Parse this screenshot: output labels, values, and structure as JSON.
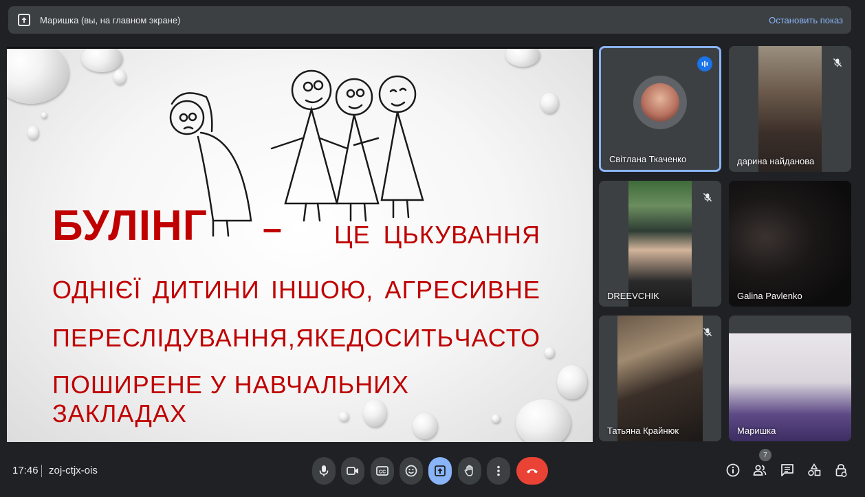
{
  "presenting_bar": {
    "text": "Маришка (вы, на главном экране)",
    "stop_label": "Остановить показ"
  },
  "slide": {
    "title": "БУЛІНГ",
    "dash": "–",
    "line0": [
      "ЦЕ",
      "ЦЬКУВАННЯ"
    ],
    "line1": [
      "ОДНІЄЇ",
      "ДИТИНИ",
      "ІНШОЮ,",
      "АГРЕСИВНЕ"
    ],
    "line2": [
      "ПЕРЕСЛІДУВАННЯ,",
      "ЯКЕ",
      "ДОСИТЬ",
      "ЧАСТО"
    ],
    "line3": "ПОШИРЕНЕ У НАВЧАЛЬНИХ ЗАКЛАДАХ"
  },
  "participants": [
    {
      "name": "Світлана Ткаченко",
      "status": "speaking"
    },
    {
      "name": "дарина найданова",
      "status": "muted"
    },
    {
      "name": "DREEVCHIK",
      "status": "muted"
    },
    {
      "name": "Galina Pavlenko",
      "status": "unmuted"
    },
    {
      "name": "Татьяна Крайнюк",
      "status": "muted"
    },
    {
      "name": "Маришка",
      "status": "unmuted"
    }
  ],
  "footer": {
    "time": "17:46",
    "meeting_code": "zoj-ctjx-ois",
    "participant_count": "7"
  },
  "colors": {
    "accent": "#8ab4f8",
    "end_call": "#ea4335",
    "slide_text": "#c00000",
    "background": "#202124"
  }
}
